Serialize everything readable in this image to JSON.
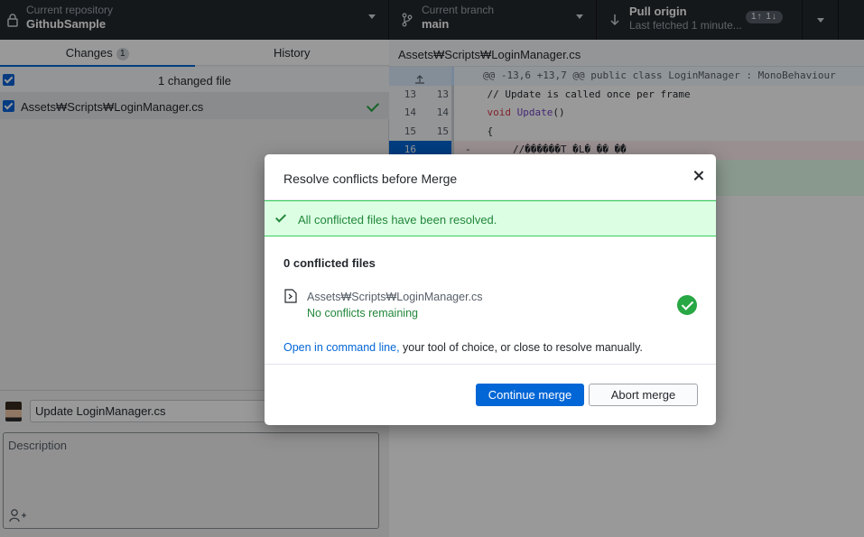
{
  "toolbar": {
    "repo_label": "Current repository",
    "repo_name": "GithubSample",
    "branch_label": "Current branch",
    "branch_name": "main",
    "pull_label": "Pull origin",
    "pull_status": "Last fetched 1 minute...",
    "pull_badge": "1↑ 1↓"
  },
  "sidebar": {
    "tabs": [
      {
        "label": "Changes",
        "count": "1"
      },
      {
        "label": "History"
      }
    ],
    "changed_summary": "1 changed file",
    "files": [
      {
        "path": "Assets₩Scripts₩LoginManager.cs"
      }
    ]
  },
  "commit": {
    "summary_value": "Update LoginManager.cs",
    "description_placeholder": "Description"
  },
  "diff": {
    "path": "Assets₩Scripts₩LoginManager.cs",
    "hunk": "@@ -13,6 +13,7 @@ public class LoginManager : MonoBehaviour",
    "lines": [
      {
        "old": "13",
        "new": "13",
        "code": "    // Update is called once per frame"
      },
      {
        "old": "14",
        "new": "14",
        "code_kw": "    void ",
        "code_fn": "Update",
        "code_rest": "()"
      },
      {
        "old": "15",
        "new": "15",
        "code": "    {"
      },
      {
        "old": "16",
        "new": "",
        "code": "-       //������T �L� �� �̂�"
      }
    ]
  },
  "dialog": {
    "title": "Resolve conflicts before Merge",
    "banner": "All conflicted files have been resolved.",
    "conflict_count": "0 conflicted files",
    "file_path": "Assets₩Scripts₩LoginManager.cs",
    "file_status": "No conflicts remaining",
    "manual_link": "Open in command line,",
    "manual_rest": " your tool of choice, or close to resolve manually.",
    "continue_label": "Continue merge",
    "abort_label": "Abort merge"
  },
  "colors": {
    "accent": "#0366d6",
    "success": "#28a745",
    "toolbar_bg": "#24292e",
    "banner_bg": "#dcffe4"
  },
  "icons": [
    "lock-icon",
    "branch-icon",
    "pull-arrow-icon",
    "checkmark-icon",
    "close-icon",
    "file-diff-icon",
    "person-add-icon",
    "expand-up-icon"
  ]
}
